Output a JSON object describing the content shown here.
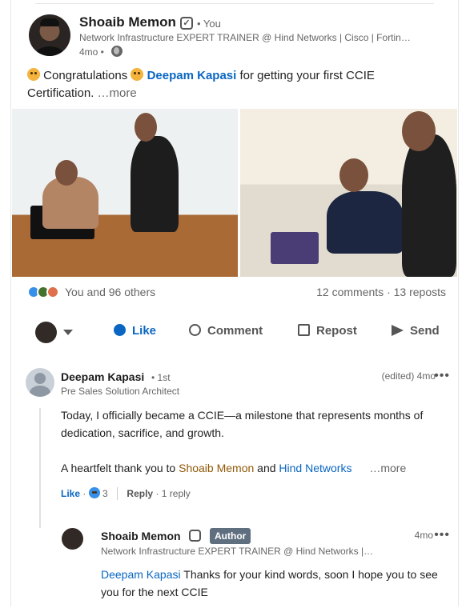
{
  "post": {
    "author": "Shoaib Memon",
    "you": "• You",
    "headline": "Network Infrastructure EXPERT TRAINER @ Hind Networks | Cisco | Fortin…",
    "time": "4mo •",
    "text_part1": "Congratulations",
    "mention": "Deepam Kapasi",
    "text_part2": "for getting your first CCIE",
    "text_line2": "Certification.",
    "more": "…more"
  },
  "stats": {
    "reactions": "You and 96 others",
    "counts": "12 comments · 13 reposts"
  },
  "actions": {
    "like": "Like",
    "comment": "Comment",
    "repost": "Repost",
    "send": "Send"
  },
  "comment": {
    "name": "Deepam Kapasi",
    "degree": "• 1st",
    "title": "Pre Sales Solution Architect",
    "edited": "(edited) 4mo",
    "body1": "Today, I officially became a CCIE—a milestone that represents months of dedication, sacrifice, and growth.",
    "body2_prefix": "A heartfelt thank you to",
    "mention1": "Shoaib Memon",
    "and": "and",
    "mention2": "Hind Networks",
    "more": "…more",
    "like": "Like",
    "like_dot": "·",
    "reaction_count": "3",
    "reply": "Reply",
    "replies": "· 1 reply"
  },
  "reply": {
    "name": "Shoaib Memon",
    "badge": "Author",
    "time": "4mo",
    "title": "Network Infrastructure EXPERT TRAINER @ Hind Networks |…",
    "mention": "Deepam Kapasi",
    "text": "Thanks for your kind words, soon I hope you to see you for the next CCIE"
  },
  "icons": [
    "verified-icon",
    "globe-icon",
    "party-emoji-icon",
    "like-icon",
    "comment-icon",
    "repost-icon",
    "send-icon",
    "more-icon"
  ]
}
